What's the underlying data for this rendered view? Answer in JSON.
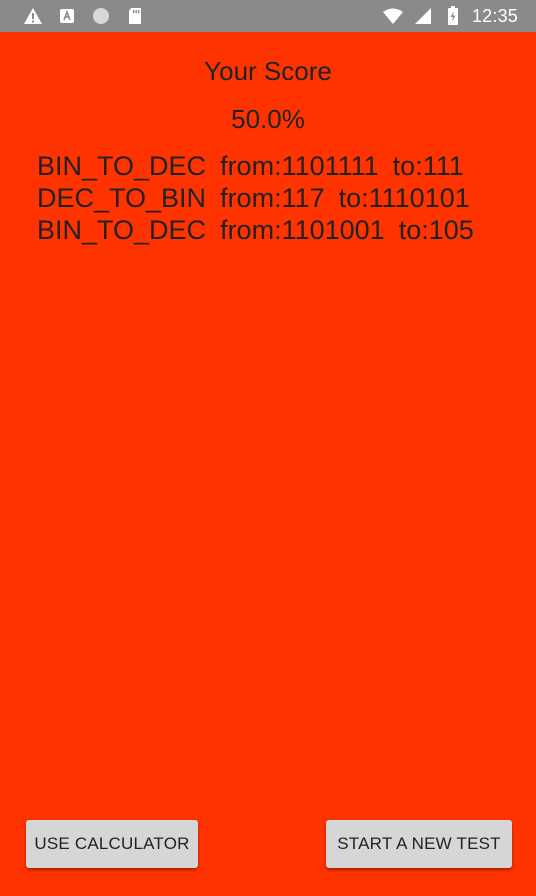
{
  "status_bar": {
    "time": "12:35",
    "icons_left": [
      "warning-icon",
      "a-icon",
      "circle-icon",
      "sd-card-icon"
    ],
    "icons_right": [
      "wifi-icon",
      "signal-icon",
      "battery-icon"
    ]
  },
  "screen": {
    "title": "Your Score",
    "score": "50.0%",
    "results": [
      {
        "type": "BIN_TO_DEC",
        "from": "from:1101111",
        "to": "to:111"
      },
      {
        "type": "DEC_TO_BIN",
        "from": "from:117",
        "to": "to:1110101"
      },
      {
        "type": "BIN_TO_DEC",
        "from": "from:1101001",
        "to": "to:105"
      }
    ]
  },
  "actions": {
    "use_calculator_label": "USE CALCULATOR",
    "start_test_label": "START A NEW TEST"
  },
  "colors": {
    "background": "#ff3300",
    "status_bar": "#8a8a8a",
    "button": "#d6d6d6"
  }
}
